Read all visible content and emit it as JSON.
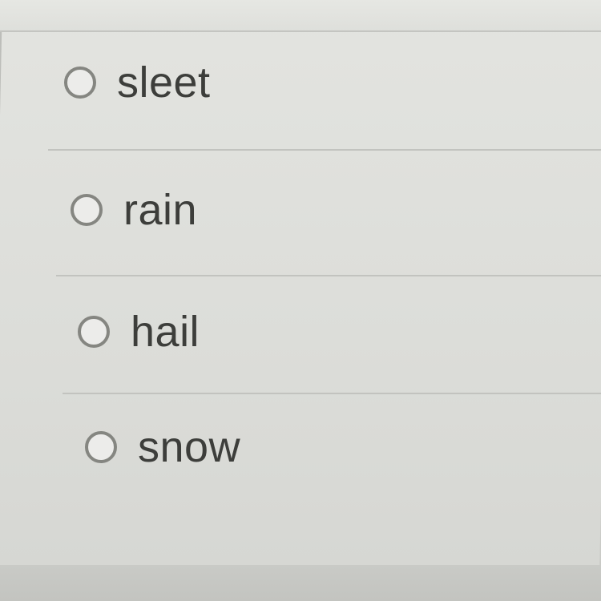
{
  "question": {
    "options": [
      {
        "label": "sleet",
        "selected": false
      },
      {
        "label": "rain",
        "selected": false
      },
      {
        "label": "hail",
        "selected": false
      },
      {
        "label": "snow",
        "selected": false
      }
    ]
  }
}
